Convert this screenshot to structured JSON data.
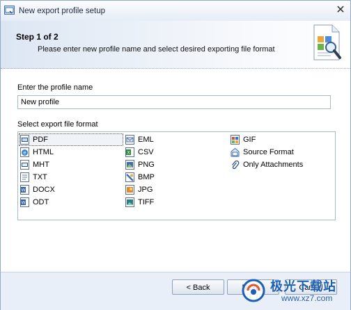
{
  "window": {
    "title": "New export profile setup",
    "close_glyph": "✕"
  },
  "header": {
    "step": "Step 1 of 2",
    "description": "Please enter new profile name and select desired exporting file format"
  },
  "form": {
    "profile_name_label": "Enter the profile name",
    "profile_name_value": "New profile",
    "format_label": "Select export file format",
    "selected_format": "PDF",
    "formats": [
      {
        "label": "PDF",
        "icon": "pdf-file-icon"
      },
      {
        "label": "HTML",
        "icon": "html-file-icon"
      },
      {
        "label": "MHT",
        "icon": "mht-file-icon"
      },
      {
        "label": "TXT",
        "icon": "txt-file-icon"
      },
      {
        "label": "DOCX",
        "icon": "docx-file-icon"
      },
      {
        "label": "ODT",
        "icon": "odt-file-icon"
      },
      {
        "label": "EML",
        "icon": "eml-file-icon"
      },
      {
        "label": "CSV",
        "icon": "csv-file-icon"
      },
      {
        "label": "PNG",
        "icon": "png-file-icon"
      },
      {
        "label": "BMP",
        "icon": "bmp-file-icon"
      },
      {
        "label": "JPG",
        "icon": "jpg-file-icon"
      },
      {
        "label": "TIFF",
        "icon": "tiff-file-icon"
      },
      {
        "label": "GIF",
        "icon": "gif-file-icon"
      },
      {
        "label": "Source Format",
        "icon": "source-format-icon"
      },
      {
        "label": "Only Attachments",
        "icon": "attachment-icon"
      }
    ]
  },
  "buttons": {
    "back": "< Back",
    "next": "Next >",
    "cancel": "Cancel"
  },
  "watermark": {
    "text": "极光下载站",
    "url": "www.xz7.com"
  },
  "colors": {
    "accent": "#1d5fb6",
    "border": "#8fa9c9",
    "footer_bg": "#e9eff8"
  }
}
